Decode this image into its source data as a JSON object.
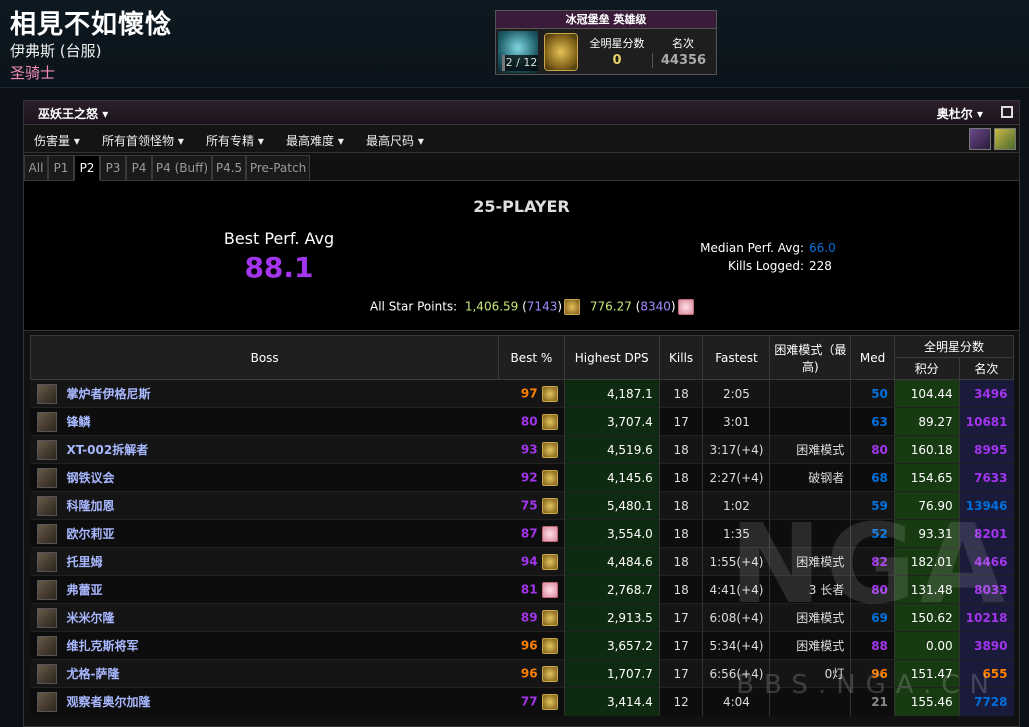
{
  "header": {
    "char_name": "相見不如懷惗",
    "realm": "伊弗斯 (台服)",
    "class": "圣骑士"
  },
  "raid_box": {
    "title": "冰冠堡垒 英雄级",
    "progress": "2 / 12",
    "score_label": "全明星分数",
    "score_value": "0",
    "rank_label": "名次",
    "rank_value": "44356"
  },
  "zone": {
    "title": "巫妖王之怒",
    "realm_selector": "奥杜尔"
  },
  "filters": [
    "伤害量",
    "所有首领怪物",
    "所有专精",
    "最高难度",
    "最高尺码"
  ],
  "tabs": [
    "All",
    "P1",
    "P2",
    "P3",
    "P4",
    "P4 (Buff)",
    "P4.5",
    "Pre-Patch"
  ],
  "active_tab": "P2",
  "summary": {
    "title": "25-PLAYER",
    "bpa_label": "Best Perf. Avg",
    "bpa_value": "88.1",
    "median_label": "Median Perf. Avg:",
    "median_value": "66.0",
    "kills_label": "Kills Logged:",
    "kills_value": "228",
    "asp_label": "All Star Points:",
    "asp1_value": "1,406.59",
    "asp1_rank": "7143",
    "asp2_value": "776.27",
    "asp2_rank": "8340"
  },
  "table": {
    "headers": {
      "boss": "Boss",
      "best": "Best %",
      "dps": "Highest DPS",
      "kills": "Kills",
      "fastest": "Fastest",
      "hard": "困难模式（最高)",
      "med": "Med",
      "asp": "全明星分数",
      "points": "积分",
      "rank": "名次"
    },
    "rows": [
      {
        "name": "掌炉者伊格尼斯",
        "best": "97",
        "best_color": "#ff8000",
        "medal": "gold",
        "dps": "4,187.1",
        "kills": "18",
        "fastest": "2:05",
        "hard": "",
        "med": "50",
        "med_color": "#0070dd",
        "points": "104.44",
        "rank": "3496",
        "rank_color": "#a335ee"
      },
      {
        "name": "锋鳞",
        "best": "80",
        "best_color": "#a335ee",
        "medal": "gold",
        "dps": "3,707.4",
        "kills": "17",
        "fastest": "3:01",
        "hard": "",
        "med": "63",
        "med_color": "#0070dd",
        "points": "89.27",
        "rank": "10681",
        "rank_color": "#a335ee"
      },
      {
        "name": "XT-002拆解者",
        "best": "93",
        "best_color": "#a335ee",
        "medal": "gold",
        "dps": "4,519.6",
        "kills": "18",
        "fastest": "3:17(+4)",
        "hard": "困难模式",
        "med": "80",
        "med_color": "#a335ee",
        "points": "160.18",
        "rank": "8995",
        "rank_color": "#a335ee"
      },
      {
        "name": "钢铁议会",
        "best": "92",
        "best_color": "#a335ee",
        "medal": "gold",
        "dps": "4,145.6",
        "kills": "18",
        "fastest": "2:27(+4)",
        "hard": "破钢者",
        "med": "68",
        "med_color": "#0070dd",
        "points": "154.65",
        "rank": "7633",
        "rank_color": "#a335ee"
      },
      {
        "name": "科隆加恩",
        "best": "75",
        "best_color": "#a335ee",
        "medal": "gold",
        "dps": "5,480.1",
        "kills": "18",
        "fastest": "1:02",
        "hard": "",
        "med": "59",
        "med_color": "#0070dd",
        "points": "76.90",
        "rank": "13946",
        "rank_color": "#0070dd"
      },
      {
        "name": "欧尔莉亚",
        "best": "87",
        "best_color": "#a335ee",
        "medal": "heart",
        "dps": "3,554.0",
        "kills": "18",
        "fastest": "1:35",
        "hard": "",
        "med": "52",
        "med_color": "#0070dd",
        "points": "93.31",
        "rank": "8201",
        "rank_color": "#a335ee"
      },
      {
        "name": "托里姆",
        "best": "94",
        "best_color": "#a335ee",
        "medal": "gold",
        "dps": "4,484.6",
        "kills": "18",
        "fastest": "1:55(+4)",
        "hard": "困难模式",
        "med": "82",
        "med_color": "#a335ee",
        "points": "182.01",
        "rank": "4466",
        "rank_color": "#a335ee"
      },
      {
        "name": "弗蕾亚",
        "best": "81",
        "best_color": "#a335ee",
        "medal": "heart",
        "dps": "2,768.7",
        "kills": "18",
        "fastest": "4:41(+4)",
        "hard": "3 长者",
        "med": "80",
        "med_color": "#a335ee",
        "points": "131.48",
        "rank": "8033",
        "rank_color": "#a335ee"
      },
      {
        "name": "米米尔隆",
        "best": "89",
        "best_color": "#a335ee",
        "medal": "gold",
        "dps": "2,913.5",
        "kills": "17",
        "fastest": "6:08(+4)",
        "hard": "困难模式",
        "med": "69",
        "med_color": "#0070dd",
        "points": "150.62",
        "rank": "10218",
        "rank_color": "#a335ee"
      },
      {
        "name": "维扎克斯将军",
        "best": "96",
        "best_color": "#ff8000",
        "medal": "gold",
        "dps": "3,657.2",
        "kills": "17",
        "fastest": "5:34(+4)",
        "hard": "困难模式",
        "med": "88",
        "med_color": "#a335ee",
        "points": "0.00",
        "rank": "3890",
        "rank_color": "#a335ee"
      },
      {
        "name": "尤格-萨隆",
        "best": "96",
        "best_color": "#ff8000",
        "medal": "gold",
        "dps": "1,707.7",
        "kills": "17",
        "fastest": "6:56(+4)",
        "hard": "0灯",
        "med": "96",
        "med_color": "#ff8000",
        "points": "151.47",
        "rank": "655",
        "rank_color": "#ff8000"
      },
      {
        "name": "观察者奥尔加隆",
        "best": "77",
        "best_color": "#a335ee",
        "medal": "gold",
        "dps": "3,414.4",
        "kills": "12",
        "fastest": "4:04",
        "hard": "",
        "med": "21",
        "med_color": "#888888",
        "points": "155.46",
        "rank": "7728",
        "rank_color": "#0070dd"
      }
    ]
  },
  "watermark": {
    "big": "NGA",
    "small": "BBS.NGA.CN"
  }
}
